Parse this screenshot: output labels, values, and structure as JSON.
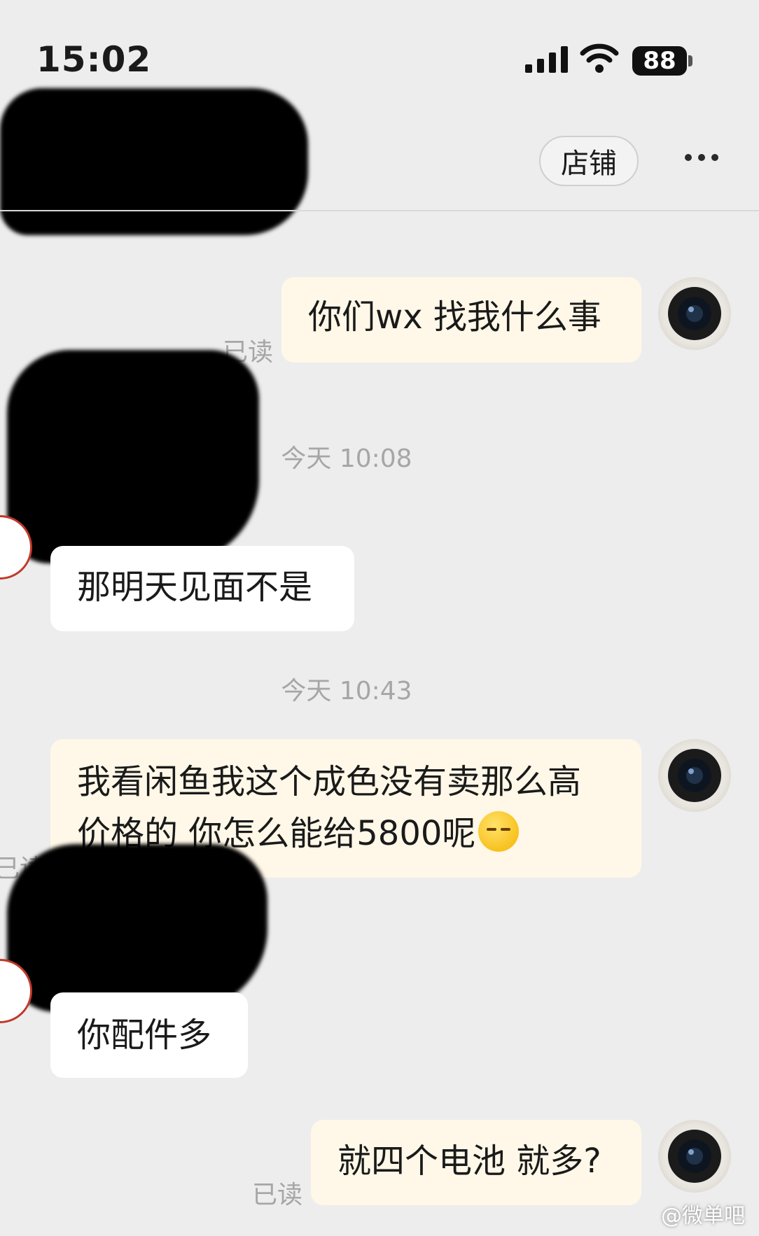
{
  "status_bar": {
    "time": "15:02",
    "battery": "88"
  },
  "header": {
    "shop_label": "店铺"
  },
  "messages": [
    {
      "from": "me",
      "text": "你们wx 找我什么事",
      "read_label": "已读"
    },
    {
      "timestamp": "今天 10:08"
    },
    {
      "from": "them",
      "text": "那明天见面不是"
    },
    {
      "timestamp": "今天 10:43"
    },
    {
      "from": "me",
      "line1": "我看闲鱼我这个成色没有卖那么高",
      "line2": "价格的 你怎么能给5800呢",
      "emoji": "dizzy-face-emoji",
      "read_label": "已读"
    },
    {
      "from": "them",
      "text": "你配件多"
    },
    {
      "from": "me",
      "text": "就四个电池 就多?",
      "read_label": "已读"
    }
  ],
  "watermark": "@微单吧",
  "colors": {
    "background": "#ededed",
    "my_bubble": "#fff8e8",
    "their_bubble": "#ffffff",
    "muted_text": "#a6a6a6"
  }
}
